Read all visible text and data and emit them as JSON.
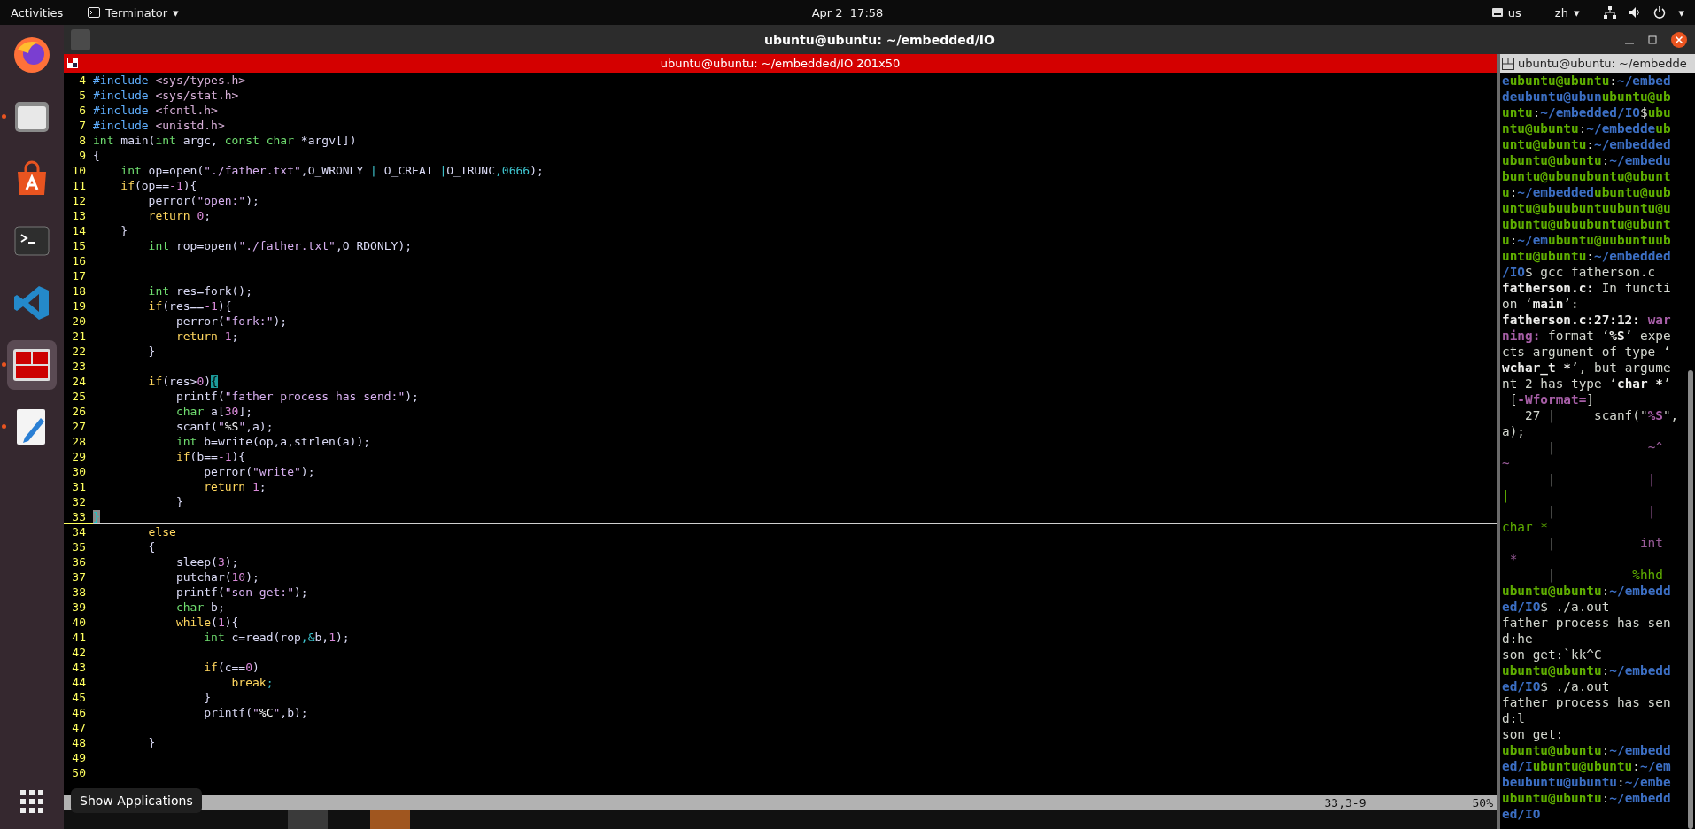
{
  "top_bar": {
    "activities": "Activities",
    "app_menu": "Terminator",
    "app_caret": "▾",
    "clock": "Apr 2  17:58",
    "keyboard": "us",
    "input_method": "zh",
    "input_caret": "▾",
    "system_caret": "▾"
  },
  "dock": {
    "items": [
      {
        "kind": "firefox",
        "running": false,
        "active": false
      },
      {
        "kind": "files",
        "running": true,
        "active": false
      },
      {
        "kind": "store",
        "running": false,
        "active": false
      },
      {
        "kind": "terminal",
        "running": false,
        "active": false
      },
      {
        "kind": "vscode",
        "running": false,
        "active": false
      },
      {
        "kind": "terminator",
        "running": true,
        "active": true
      },
      {
        "kind": "editor",
        "running": true,
        "active": false
      }
    ],
    "tooltip": "Show Applications"
  },
  "window": {
    "title": "ubuntu@ubuntu: ~/embedded/IO"
  },
  "left_pane": {
    "title": "ubuntu@ubuntu: ~/embedded/IO 201x50",
    "status": {
      "position": "33,3-9",
      "percent": "50%"
    },
    "lines": [
      {
        "n": "4",
        "current": false,
        "tokens": [
          {
            "kind": "pre",
            "text": "#include "
          },
          {
            "kind": "inc",
            "text": "<sys/types.h>"
          }
        ]
      },
      {
        "n": "5",
        "current": false,
        "tokens": [
          {
            "kind": "pre",
            "text": "#include "
          },
          {
            "kind": "inc",
            "text": "<sys/stat.h>"
          }
        ]
      },
      {
        "n": "6",
        "current": false,
        "tokens": [
          {
            "kind": "pre",
            "text": "#include "
          },
          {
            "kind": "inc",
            "text": "<fcntl.h>"
          }
        ]
      },
      {
        "n": "7",
        "current": false,
        "tokens": [
          {
            "kind": "pre",
            "text": "#include "
          },
          {
            "kind": "inc",
            "text": "<unistd.h>"
          }
        ]
      },
      {
        "n": "8",
        "current": false,
        "tokens": [
          {
            "kind": "t",
            "text": "int"
          },
          {
            "kind": "p",
            "text": " main("
          },
          {
            "kind": "t",
            "text": "int"
          },
          {
            "kind": "p",
            "text": " argc, "
          },
          {
            "kind": "t",
            "text": "const char"
          },
          {
            "kind": "p",
            "text": " *argv[])"
          }
        ]
      },
      {
        "n": "9",
        "current": false,
        "tokens": [
          {
            "kind": "p",
            "text": "{"
          }
        ]
      },
      {
        "n": "10",
        "current": false,
        "tokens": [
          {
            "kind": "t",
            "text": "    int"
          },
          {
            "kind": "p",
            "text": " op=open("
          },
          {
            "kind": "s",
            "text": "\"./father.txt\""
          },
          {
            "kind": "p",
            "text": ",O_WRONLY "
          },
          {
            "kind": "o",
            "text": "|"
          },
          {
            "kind": "p",
            "text": " O_CREAT "
          },
          {
            "kind": "o",
            "text": "|"
          },
          {
            "kind": "p",
            "text": "O_TRUNC"
          },
          {
            "kind": "o",
            "text": ",0666"
          },
          {
            "kind": "p",
            "text": ");"
          }
        ]
      },
      {
        "n": "11",
        "current": false,
        "tokens": [
          {
            "kind": "k",
            "text": "    if"
          },
          {
            "kind": "p",
            "text": "(op=="
          },
          {
            "kind": "n",
            "text": "-1"
          },
          {
            "kind": "p",
            "text": "){"
          }
        ]
      },
      {
        "n": "12",
        "current": false,
        "tokens": [
          {
            "kind": "p",
            "text": "        perror("
          },
          {
            "kind": "s",
            "text": "\"open:\""
          },
          {
            "kind": "p",
            "text": ");"
          }
        ]
      },
      {
        "n": "13",
        "current": false,
        "tokens": [
          {
            "kind": "k",
            "text": "        return"
          },
          {
            "kind": "n",
            "text": " 0"
          },
          {
            "kind": "p",
            "text": ";"
          }
        ]
      },
      {
        "n": "14",
        "current": false,
        "tokens": [
          {
            "kind": "p",
            "text": "    }"
          }
        ]
      },
      {
        "n": "15",
        "current": false,
        "tokens": [
          {
            "kind": "t",
            "text": "        int"
          },
          {
            "kind": "p",
            "text": " rop=open("
          },
          {
            "kind": "s",
            "text": "\"./father.txt\""
          },
          {
            "kind": "p",
            "text": ",O_RDONLY);"
          }
        ]
      },
      {
        "n": "16",
        "current": false
      },
      {
        "n": "17",
        "current": false
      },
      {
        "n": "18",
        "current": false,
        "tokens": [
          {
            "kind": "t",
            "text": "        int"
          },
          {
            "kind": "p",
            "text": " res=fork();"
          }
        ]
      },
      {
        "n": "19",
        "current": false,
        "tokens": [
          {
            "kind": "k",
            "text": "        if"
          },
          {
            "kind": "p",
            "text": "(res=="
          },
          {
            "kind": "n",
            "text": "-1"
          },
          {
            "kind": "p",
            "text": "){"
          }
        ]
      },
      {
        "n": "20",
        "current": false,
        "tokens": [
          {
            "kind": "p",
            "text": "            perror("
          },
          {
            "kind": "s",
            "text": "\"fork:\""
          },
          {
            "kind": "p",
            "text": ");"
          }
        ]
      },
      {
        "n": "21",
        "current": false,
        "tokens": [
          {
            "kind": "k",
            "text": "            return"
          },
          {
            "kind": "n",
            "text": " 1"
          },
          {
            "kind": "p",
            "text": ";"
          }
        ]
      },
      {
        "n": "22",
        "current": false,
        "tokens": [
          {
            "kind": "p",
            "text": "        }"
          }
        ]
      },
      {
        "n": "23",
        "current": false
      },
      {
        "n": "24",
        "current": false,
        "tokens": [
          {
            "kind": "k",
            "text": "        if"
          },
          {
            "kind": "p",
            "text": "(res>"
          },
          {
            "kind": "n",
            "text": "0"
          },
          {
            "kind": "p",
            "text": ")"
          },
          {
            "kind": "match",
            "text": "{"
          }
        ]
      },
      {
        "n": "25",
        "current": false,
        "tokens": [
          {
            "kind": "p",
            "text": "            printf("
          },
          {
            "kind": "s",
            "text": "\"father process has send:\""
          },
          {
            "kind": "p",
            "text": ");"
          }
        ]
      },
      {
        "n": "26",
        "current": false,
        "tokens": [
          {
            "kind": "t",
            "text": "            char"
          },
          {
            "kind": "p",
            "text": " a["
          },
          {
            "kind": "n",
            "text": "30"
          },
          {
            "kind": "p",
            "text": "];"
          }
        ]
      },
      {
        "n": "27",
        "current": false,
        "tokens": [
          {
            "kind": "p",
            "text": "            scanf("
          },
          {
            "kind": "s",
            "text": "\""
          },
          {
            "kind": "f",
            "text": "%S"
          },
          {
            "kind": "s",
            "text": "\""
          },
          {
            "kind": "p",
            "text": ",a);"
          }
        ]
      },
      {
        "n": "28",
        "current": false,
        "tokens": [
          {
            "kind": "t",
            "text": "            int"
          },
          {
            "kind": "p",
            "text": " b=write(op,a,strlen(a));"
          }
        ]
      },
      {
        "n": "29",
        "current": false,
        "tokens": [
          {
            "kind": "k",
            "text": "            if"
          },
          {
            "kind": "p",
            "text": "(b=="
          },
          {
            "kind": "n",
            "text": "-1"
          },
          {
            "kind": "p",
            "text": "){"
          }
        ]
      },
      {
        "n": "30",
        "current": false,
        "tokens": [
          {
            "kind": "p",
            "text": "                perror("
          },
          {
            "kind": "s",
            "text": "\"write\""
          },
          {
            "kind": "p",
            "text": ");"
          }
        ]
      },
      {
        "n": "31",
        "current": false,
        "tokens": [
          {
            "kind": "k",
            "text": "                return"
          },
          {
            "kind": "n",
            "text": " 1"
          },
          {
            "kind": "p",
            "text": ";"
          }
        ]
      },
      {
        "n": "32",
        "current": false,
        "tokens": [
          {
            "kind": "p",
            "text": "            }"
          }
        ]
      },
      {
        "n": "33",
        "current": true,
        "tokens": [
          {
            "kind": "cursor",
            "text": "}"
          }
        ]
      },
      {
        "n": "34",
        "current": false,
        "tokens": [
          {
            "kind": "k",
            "text": "        else"
          }
        ]
      },
      {
        "n": "35",
        "current": false,
        "tokens": [
          {
            "kind": "p",
            "text": "        {"
          }
        ]
      },
      {
        "n": "36",
        "current": false,
        "tokens": [
          {
            "kind": "p",
            "text": "            sleep("
          },
          {
            "kind": "n",
            "text": "3"
          },
          {
            "kind": "p",
            "text": ");"
          }
        ]
      },
      {
        "n": "37",
        "current": false,
        "tokens": [
          {
            "kind": "p",
            "text": "            putchar("
          },
          {
            "kind": "n",
            "text": "10"
          },
          {
            "kind": "p",
            "text": ");"
          }
        ]
      },
      {
        "n": "38",
        "current": false,
        "tokens": [
          {
            "kind": "p",
            "text": "            printf("
          },
          {
            "kind": "s",
            "text": "\"son get:\""
          },
          {
            "kind": "p",
            "text": ");"
          }
        ]
      },
      {
        "n": "39",
        "current": false,
        "tokens": [
          {
            "kind": "t",
            "text": "            char"
          },
          {
            "kind": "p",
            "text": " b;"
          }
        ]
      },
      {
        "n": "40",
        "current": false,
        "tokens": [
          {
            "kind": "k",
            "text": "            while"
          },
          {
            "kind": "p",
            "text": "("
          },
          {
            "kind": "n",
            "text": "1"
          },
          {
            "kind": "p",
            "text": "){"
          }
        ]
      },
      {
        "n": "41",
        "current": false,
        "tokens": [
          {
            "kind": "t",
            "text": "                int"
          },
          {
            "kind": "p",
            "text": " c=read(rop"
          },
          {
            "kind": "o",
            "text": ",&"
          },
          {
            "kind": "p",
            "text": "b,"
          },
          {
            "kind": "n",
            "text": "1"
          },
          {
            "kind": "p",
            "text": ");"
          }
        ]
      },
      {
        "n": "42",
        "current": false
      },
      {
        "n": "43",
        "current": false,
        "tokens": [
          {
            "kind": "k",
            "text": "                if"
          },
          {
            "kind": "p",
            "text": "(c=="
          },
          {
            "kind": "n",
            "text": "0"
          },
          {
            "kind": "p",
            "text": ")"
          }
        ]
      },
      {
        "n": "44",
        "current": false,
        "tokens": [
          {
            "kind": "k",
            "text": "                    break"
          },
          {
            "kind": "o",
            "text": ";"
          }
        ]
      },
      {
        "n": "45",
        "current": false,
        "tokens": [
          {
            "kind": "p",
            "text": "                }"
          }
        ]
      },
      {
        "n": "46",
        "current": false,
        "tokens": [
          {
            "kind": "p",
            "text": "                printf("
          },
          {
            "kind": "s",
            "text": "\""
          },
          {
            "kind": "f",
            "text": "%C"
          },
          {
            "kind": "s",
            "text": "\""
          },
          {
            "kind": "p",
            "text": ",b);"
          }
        ]
      },
      {
        "n": "47",
        "current": false
      },
      {
        "n": "48",
        "current": false,
        "tokens": [
          {
            "kind": "p",
            "text": "        }"
          }
        ]
      },
      {
        "n": "49",
        "current": false
      },
      {
        "n": "50",
        "current": false
      }
    ]
  },
  "right_pane": {
    "title": "ubuntu@ubuntu: ~/embedde",
    "lines": [
      [
        {
          "kind": "path",
          "text": "e"
        },
        {
          "kind": "user",
          "text": "ubuntu@ubuntu"
        },
        {
          "kind": "p",
          "text": ":"
        },
        {
          "kind": "path",
          "text": "~/embed"
        }
      ],
      [
        {
          "kind": "path",
          "text": "deubuntu@ubun"
        },
        {
          "kind": "user",
          "text": "ubuntu@ub"
        }
      ],
      [
        {
          "kind": "user",
          "text": "untu"
        },
        {
          "kind": "p",
          "text": ":"
        },
        {
          "kind": "path",
          "text": "~/embedded/IO"
        },
        {
          "kind": "p",
          "text": "$"
        },
        {
          "kind": "user",
          "text": "ubu"
        }
      ],
      [
        {
          "kind": "user",
          "text": "ntu@ubuntu"
        },
        {
          "kind": "p",
          "text": ":"
        },
        {
          "kind": "path",
          "text": "~/embedde"
        },
        {
          "kind": "user",
          "text": "ub"
        }
      ],
      [
        {
          "kind": "user",
          "text": "untu@ubuntu"
        },
        {
          "kind": "p",
          "text": ":"
        },
        {
          "kind": "path",
          "text": "~/embedded"
        }
      ],
      [
        {
          "kind": "user",
          "text": "ubuntu@ubuntu"
        },
        {
          "kind": "p",
          "text": ":"
        },
        {
          "kind": "path",
          "text": "~/embedu"
        }
      ],
      [
        {
          "kind": "user",
          "text": "buntu@ubunubuntu@ubunt"
        }
      ],
      [
        {
          "kind": "user",
          "text": "u"
        },
        {
          "kind": "p",
          "text": ":"
        },
        {
          "kind": "path",
          "text": "~/embedded"
        },
        {
          "kind": "user",
          "text": "ubuntu@uub"
        }
      ],
      [
        {
          "kind": "user",
          "text": "untu@ubuubuntuubuntu@u"
        }
      ],
      [
        {
          "kind": "user",
          "text": "ubuntu@ubuubuntu@ubunt"
        }
      ],
      [
        {
          "kind": "user",
          "text": "u"
        },
        {
          "kind": "p",
          "text": ":"
        },
        {
          "kind": "path",
          "text": "~/em"
        },
        {
          "kind": "user",
          "text": "ubuntu@uubuntuub"
        }
      ],
      [
        {
          "kind": "user",
          "text": "untu@ubuntu"
        },
        {
          "kind": "p",
          "text": ":"
        },
        {
          "kind": "path",
          "text": "~/embedded"
        }
      ],
      [
        {
          "kind": "path",
          "text": "/IO"
        },
        {
          "kind": "p",
          "text": "$ gcc fatherson.c"
        }
      ],
      [
        {
          "kind": "b",
          "text": "fatherson.c:"
        },
        {
          "kind": "p",
          "text": " In functi"
        }
      ],
      [
        {
          "kind": "p",
          "text": "on ‘"
        },
        {
          "kind": "b",
          "text": "main"
        },
        {
          "kind": "p",
          "text": "’:"
        }
      ],
      [
        {
          "kind": "b",
          "text": "fatherson.c:27:12: "
        },
        {
          "kind": "w",
          "text": "war"
        }
      ],
      [
        {
          "kind": "w",
          "text": "ning:"
        },
        {
          "kind": "p",
          "text": " format ‘"
        },
        {
          "kind": "b",
          "text": "%S"
        },
        {
          "kind": "p",
          "text": "’ expe"
        }
      ],
      [
        {
          "kind": "p",
          "text": "cts argument of type ‘"
        }
      ],
      [
        {
          "kind": "b",
          "text": "wchar_t *"
        },
        {
          "kind": "p",
          "text": "’, but argume"
        }
      ],
      [
        {
          "kind": "p",
          "text": "nt 2 has type ‘"
        },
        {
          "kind": "b",
          "text": "char *"
        },
        {
          "kind": "p",
          "text": "’"
        }
      ],
      [
        {
          "kind": "p",
          "text": " ["
        },
        {
          "kind": "w",
          "text": "-Wformat="
        },
        {
          "kind": "p",
          "text": "]"
        }
      ],
      [
        {
          "kind": "p",
          "text": "   27 |     scanf(\""
        },
        {
          "kind": "w",
          "text": "%S"
        },
        {
          "kind": "p",
          "text": "\","
        }
      ],
      [
        {
          "kind": "p",
          "text": "a);"
        }
      ],
      [
        {
          "kind": "p",
          "text": "      |            "
        },
        {
          "kind": "m",
          "text": "~^"
        }
      ],
      [
        {
          "kind": "m",
          "text": "~"
        }
      ],
      [
        {
          "kind": "p",
          "text": "      |            "
        },
        {
          "kind": "m",
          "text": "|"
        }
      ],
      [
        {
          "kind": "g",
          "text": "|"
        }
      ],
      [
        {
          "kind": "p",
          "text": "      |            "
        },
        {
          "kind": "m",
          "text": "|"
        }
      ],
      [
        {
          "kind": "g",
          "text": "char *"
        }
      ],
      [
        {
          "kind": "p",
          "text": "      |           "
        },
        {
          "kind": "m",
          "text": "int"
        }
      ],
      [
        {
          "kind": "m",
          "text": " *"
        }
      ],
      [
        {
          "kind": "p",
          "text": "      |          "
        },
        {
          "kind": "g",
          "text": "%hhd"
        }
      ],
      [
        {
          "kind": "user",
          "text": "ubuntu@ubuntu"
        },
        {
          "kind": "p",
          "text": ":"
        },
        {
          "kind": "path",
          "text": "~/embedd"
        }
      ],
      [
        {
          "kind": "path",
          "text": "ed/IO"
        },
        {
          "kind": "p",
          "text": "$ ./a.out"
        }
      ],
      [
        {
          "kind": "p",
          "text": "father process has sen"
        }
      ],
      [
        {
          "kind": "p",
          "text": "d:he"
        }
      ],
      [
        {
          "kind": "p",
          "text": "son get:`kk^C"
        }
      ],
      [
        {
          "kind": "user",
          "text": "ubuntu@ubuntu"
        },
        {
          "kind": "p",
          "text": ":"
        },
        {
          "kind": "path",
          "text": "~/embedd"
        }
      ],
      [
        {
          "kind": "path",
          "text": "ed/IO"
        },
        {
          "kind": "p",
          "text": "$ ./a.out"
        }
      ],
      [
        {
          "kind": "p",
          "text": "father process has sen"
        }
      ],
      [
        {
          "kind": "p",
          "text": "d:l"
        }
      ],
      [
        {
          "kind": "p",
          "text": "son get:"
        }
      ],
      [
        {
          "kind": "user",
          "text": "ubuntu@ubuntu"
        },
        {
          "kind": "p",
          "text": ":"
        },
        {
          "kind": "path",
          "text": "~/embedd"
        }
      ],
      [
        {
          "kind": "path",
          "text": "ed/I"
        },
        {
          "kind": "user",
          "text": "ubuntu@ubuntu"
        },
        {
          "kind": "p",
          "text": ":"
        },
        {
          "kind": "path",
          "text": "~/em"
        }
      ],
      [
        {
          "kind": "path",
          "text": "beubuntu@ubuntu"
        },
        {
          "kind": "p",
          "text": ":"
        },
        {
          "kind": "path",
          "text": "~/embe"
        }
      ],
      [
        {
          "kind": "user",
          "text": "ubuntu@ubuntu"
        },
        {
          "kind": "p",
          "text": ":"
        },
        {
          "kind": "path",
          "text": "~/embedd"
        }
      ],
      [
        {
          "kind": "path",
          "text": "ed/IO"
        }
      ]
    ]
  }
}
